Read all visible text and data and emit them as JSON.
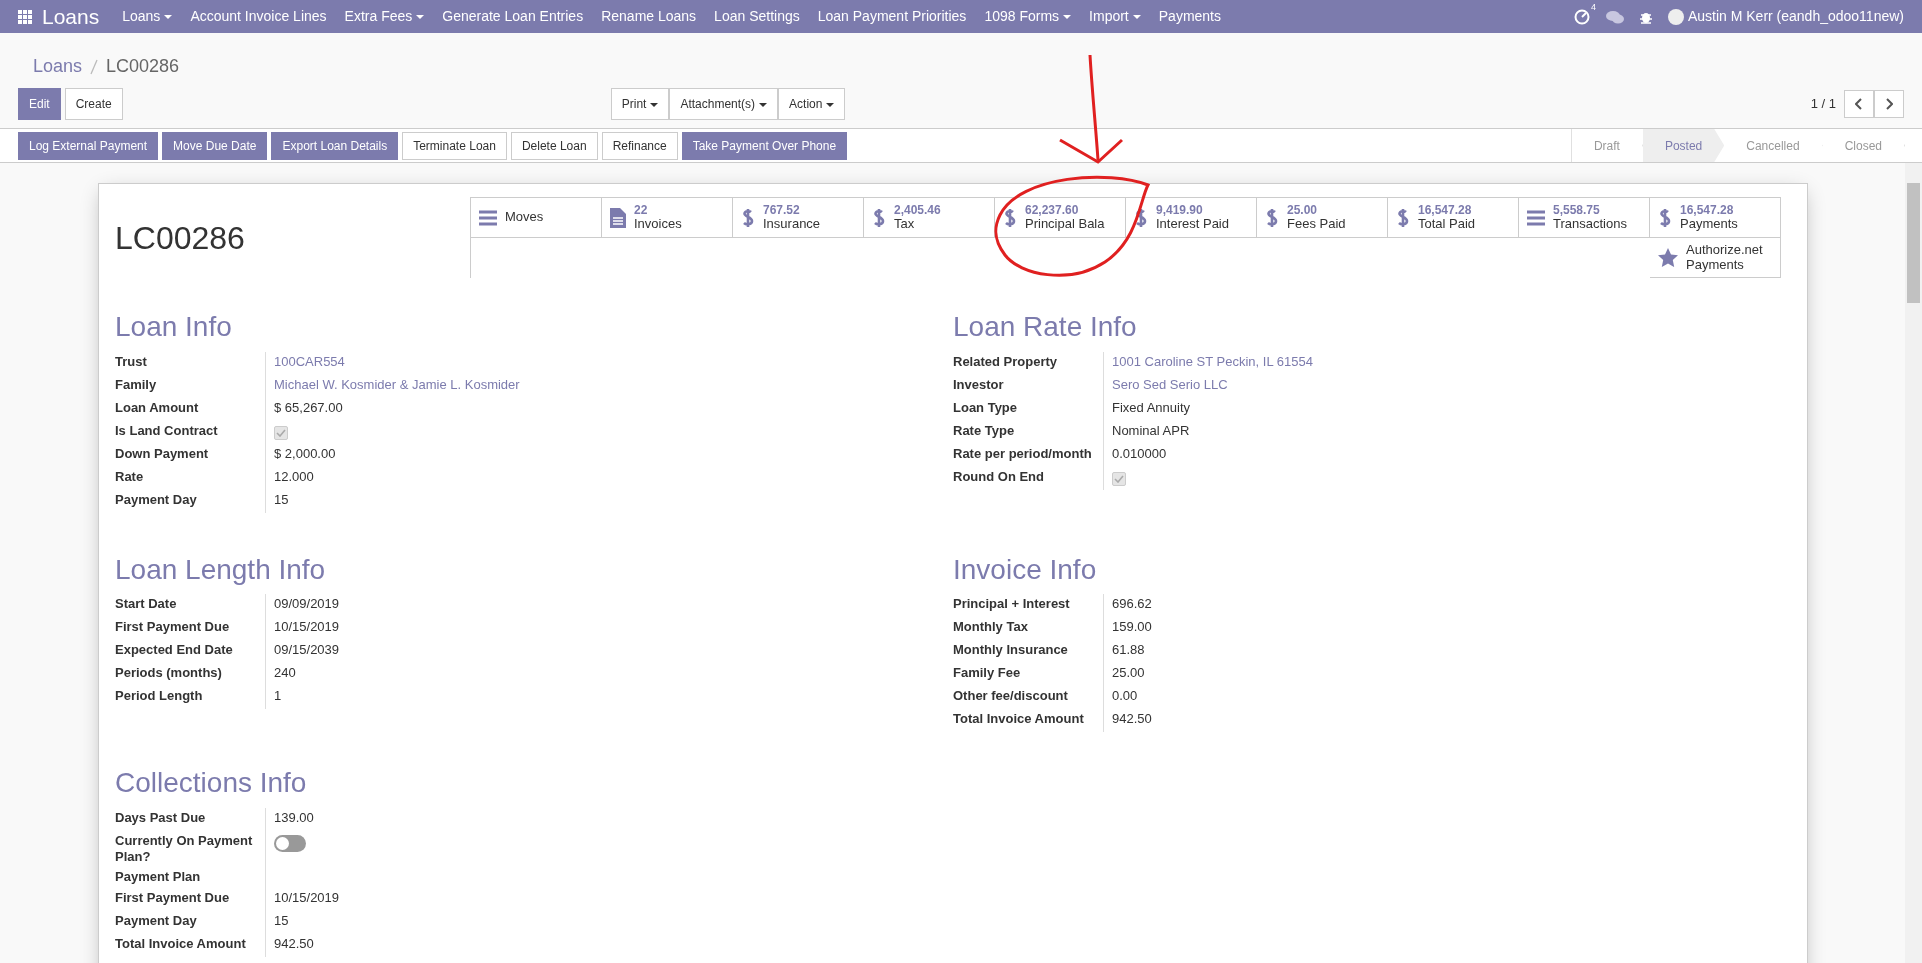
{
  "navbar": {
    "app_title": "Loans",
    "menus": [
      {
        "label": "Loans",
        "dropdown": true
      },
      {
        "label": "Account Invoice Lines",
        "dropdown": false
      },
      {
        "label": "Extra Fees",
        "dropdown": true
      },
      {
        "label": "Generate Loan Entries",
        "dropdown": false
      },
      {
        "label": "Rename Loans",
        "dropdown": false
      },
      {
        "label": "Loan Settings",
        "dropdown": false
      },
      {
        "label": "Loan Payment Priorities",
        "dropdown": false
      },
      {
        "label": "1098 Forms",
        "dropdown": true
      },
      {
        "label": "Import",
        "dropdown": true
      },
      {
        "label": "Payments",
        "dropdown": false
      }
    ],
    "activity_count": "4",
    "user": "Austin M Kerr (eandh_odoo11new)"
  },
  "breadcrumb": [
    "Loans",
    "LC00286"
  ],
  "main_buttons": [
    {
      "label": "Edit",
      "kind": "primary"
    },
    {
      "label": "Create",
      "kind": "secondary"
    }
  ],
  "sidebar_menus": [
    "Print",
    "Attachment(s)",
    "Action"
  ],
  "pager": "1 / 1",
  "header_buttons": [
    {
      "label": "Log External Payment",
      "kind": "primary"
    },
    {
      "label": "Move Due Date",
      "kind": "primary"
    },
    {
      "label": "Export Loan Details",
      "kind": "primary"
    },
    {
      "label": "Terminate Loan",
      "kind": "secondary"
    },
    {
      "label": "Delete Loan",
      "kind": "secondary"
    },
    {
      "label": "Refinance",
      "kind": "secondary"
    },
    {
      "label": "Take Payment Over Phone",
      "kind": "primary"
    }
  ],
  "status_bar": [
    {
      "label": "Draft",
      "selected": false
    },
    {
      "label": "Posted",
      "selected": true
    },
    {
      "label": "Cancelled",
      "selected": false
    },
    {
      "label": "Closed",
      "selected": false
    }
  ],
  "record_title": "LC00286",
  "stat_buttons": [
    {
      "kind": "list",
      "label": "Moves"
    },
    {
      "kind": "document",
      "value": "22",
      "label": "Invoices"
    },
    {
      "kind": "amount",
      "value": "767.52",
      "label": "Insurance"
    },
    {
      "kind": "amount",
      "value": "2,405.46",
      "label": "Tax"
    },
    {
      "kind": "amount",
      "value": "62,237.60",
      "label": "Principal Bala"
    },
    {
      "kind": "amount",
      "value": "9,419.90",
      "label": "Interest Paid"
    },
    {
      "kind": "amount",
      "value": "25.00",
      "label": "Fees Paid"
    },
    {
      "kind": "amount",
      "value": "16,547.28",
      "label": "Total Paid"
    },
    {
      "kind": "list",
      "value": "5,558.75",
      "label": "Transactions"
    },
    {
      "kind": "amount",
      "value": "16,547.28",
      "label": "Payments"
    },
    {
      "kind": "rated",
      "label": "Authorize.net Payments"
    }
  ],
  "section_rows": [
    [
      {
        "title": "Loan Info",
        "fields": [
          {
            "label": "Trust",
            "kind": "link",
            "value": "100CAR554"
          },
          {
            "label": "Family",
            "kind": "link",
            "value": "Michael W. Kosmider & Jamie L. Kosmider"
          },
          {
            "label": "Loan Amount",
            "kind": "text",
            "value": "$ 65,267.00"
          },
          {
            "label": "Is Land Contract",
            "kind": "checkbox",
            "checked": true
          },
          {
            "label": "Down Payment",
            "kind": "text",
            "value": "$ 2,000.00"
          },
          {
            "label": "Rate",
            "kind": "text",
            "value": "12.000"
          },
          {
            "label": "Payment Day",
            "kind": "text",
            "value": "15"
          }
        ]
      },
      {
        "title": "Loan Rate Info",
        "fields": [
          {
            "label": "Related Property",
            "kind": "link",
            "value": "1001 Caroline ST Peckin, IL 61554"
          },
          {
            "label": "Investor",
            "kind": "link",
            "value": "Sero Sed Serio LLC"
          },
          {
            "label": "Loan Type",
            "kind": "text",
            "value": "Fixed Annuity"
          },
          {
            "label": "Rate Type",
            "kind": "text",
            "value": "Nominal APR"
          },
          {
            "label": "Rate per period/month",
            "kind": "text",
            "value": "0.010000"
          },
          {
            "label": "Round On End",
            "kind": "checkbox",
            "checked": true
          }
        ]
      }
    ],
    [
      {
        "title": "Loan Length Info",
        "fields": [
          {
            "label": "Start Date",
            "kind": "text",
            "value": "09/09/2019"
          },
          {
            "label": "First Payment Due",
            "kind": "text",
            "value": "10/15/2019"
          },
          {
            "label": "Expected End Date",
            "kind": "text",
            "value": "09/15/2039"
          },
          {
            "label": "Periods (months)",
            "kind": "text",
            "value": "240"
          },
          {
            "label": "Period Length",
            "kind": "text",
            "value": "1"
          }
        ]
      },
      {
        "title": "Invoice Info",
        "fields": [
          {
            "label": "Principal + Interest",
            "kind": "text",
            "value": "696.62"
          },
          {
            "label": "Monthly Tax",
            "kind": "text",
            "value": "159.00"
          },
          {
            "label": "Monthly Insurance",
            "kind": "text",
            "value": "61.88"
          },
          {
            "label": "Family Fee",
            "kind": "text",
            "value": "25.00"
          },
          {
            "label": "Other fee/discount",
            "kind": "text",
            "value": "0.00"
          },
          {
            "label": "Total Invoice Amount",
            "kind": "text",
            "value": "942.50"
          }
        ]
      }
    ],
    [
      {
        "title": "Collections Info",
        "fields": [
          {
            "label": "Days Past Due",
            "kind": "text",
            "value": "139.00"
          },
          {
            "label": "Currently On Payment Plan?",
            "kind": "toggle",
            "on": false
          },
          {
            "label": "Payment Plan",
            "kind": "empty"
          },
          {
            "label": "First Payment Due",
            "kind": "text",
            "value": "10/15/2019"
          },
          {
            "label": "Payment Day",
            "kind": "text",
            "value": "15"
          },
          {
            "label": "Total Invoice Amount",
            "kind": "text",
            "value": "942.50"
          }
        ]
      }
    ]
  ]
}
